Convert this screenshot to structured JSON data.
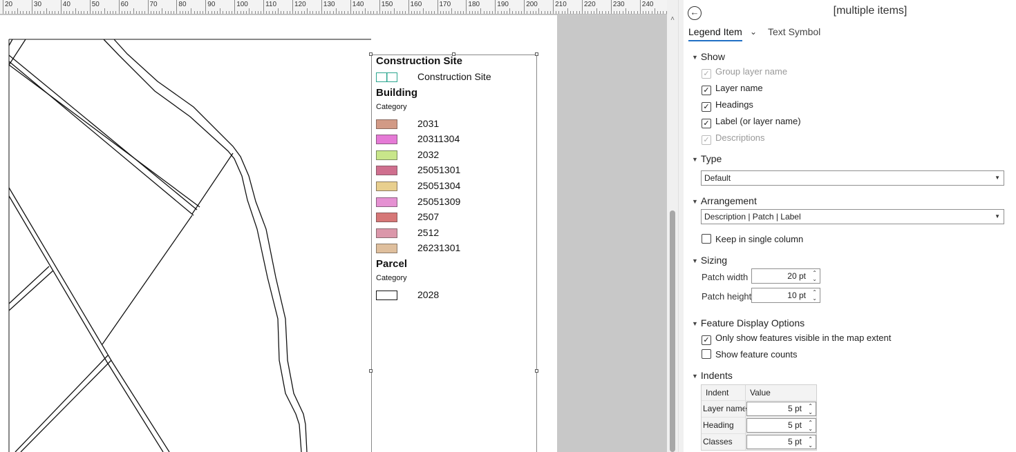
{
  "ruler": {
    "labels": [
      "20",
      "30",
      "40",
      "50",
      "60",
      "70",
      "80",
      "90",
      "100",
      "110",
      "120",
      "130",
      "140",
      "150",
      "160",
      "170",
      "180",
      "190",
      "200",
      "210",
      "220",
      "230",
      "240"
    ]
  },
  "legend": {
    "groups": [
      {
        "heading": "Construction Site",
        "subheading": "",
        "items": [
          {
            "label": "Construction Site",
            "fill": "#ffffff",
            "stroke": "#2aa58e",
            "style": "double"
          }
        ]
      },
      {
        "heading": "Building",
        "subheading": "Category",
        "items": [
          {
            "label": "2031",
            "fill": "#d29a86",
            "stroke": "#8a6a60"
          },
          {
            "label": "20311304",
            "fill": "#e57ad6",
            "stroke": "#8a5a80"
          },
          {
            "label": "2032",
            "fill": "#c8e68a",
            "stroke": "#7a8a60"
          },
          {
            "label": "25051301",
            "fill": "#cf6f8e",
            "stroke": "#8a5a6a"
          },
          {
            "label": "25051304",
            "fill": "#e8cf8e",
            "stroke": "#8a7a60"
          },
          {
            "label": "25051309",
            "fill": "#e591d2",
            "stroke": "#8a6080"
          },
          {
            "label": "2507",
            "fill": "#d67777",
            "stroke": "#8a5a5a"
          },
          {
            "label": "2512",
            "fill": "#db97aa",
            "stroke": "#8a6a70"
          },
          {
            "label": "26231301",
            "fill": "#dfbf9d",
            "stroke": "#8a7a6a"
          }
        ]
      },
      {
        "heading": "Parcel",
        "subheading": "Category",
        "items": [
          {
            "label": "2028",
            "fill": "#ffffff",
            "stroke": "#111111"
          }
        ]
      }
    ]
  },
  "pane": {
    "title": "[multiple items]",
    "tabs": {
      "legend_item": "Legend Item",
      "text_symbol": "Text Symbol"
    },
    "show": {
      "title": "Show",
      "options": [
        {
          "label": "Group layer name",
          "checked": true,
          "disabled": true
        },
        {
          "label": "Layer name",
          "checked": true,
          "disabled": false
        },
        {
          "label": "Headings",
          "checked": true,
          "disabled": false
        },
        {
          "label": "Label (or layer name)",
          "checked": true,
          "disabled": false
        },
        {
          "label": "Descriptions",
          "checked": true,
          "disabled": true
        }
      ]
    },
    "type": {
      "title": "Type",
      "value": "Default"
    },
    "arrangement": {
      "title": "Arrangement",
      "value": "Description | Patch | Label",
      "single_column_label": "Keep in single column",
      "single_column_checked": false
    },
    "sizing": {
      "title": "Sizing",
      "patch_width_label": "Patch width",
      "patch_width_value": "20 pt",
      "patch_height_label": "Patch height",
      "patch_height_value": "10 pt"
    },
    "feature_display": {
      "title": "Feature Display Options",
      "visible_only_label": "Only show features visible in the map extent",
      "visible_only_checked": true,
      "show_counts_label": "Show feature counts",
      "show_counts_checked": false
    },
    "indents": {
      "title": "Indents",
      "col_indent": "Indent",
      "col_value": "Value",
      "rows": [
        {
          "name": "Layer name",
          "value": "5 pt"
        },
        {
          "name": "Heading",
          "value": "5 pt"
        },
        {
          "name": "Classes",
          "value": "5 pt"
        }
      ]
    }
  }
}
